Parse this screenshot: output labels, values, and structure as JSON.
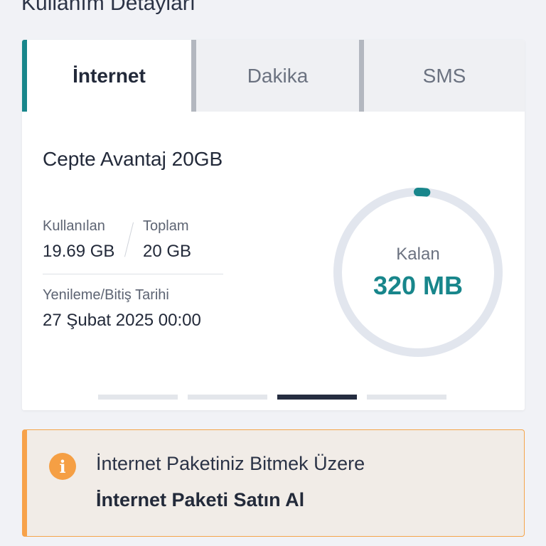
{
  "page": {
    "heading": "Kullanım Detayları"
  },
  "tabs": [
    {
      "label": "İnternet",
      "active": true
    },
    {
      "label": "Dakika",
      "active": false
    },
    {
      "label": "SMS",
      "active": false
    }
  ],
  "package": {
    "name": "Cepte Avantaj 20GB",
    "used_label": "Kullanılan",
    "used_value": "19.69 GB",
    "total_label": "Toplam",
    "total_value": "20 GB",
    "renewal_label": "Yenileme/Bitiş Tarihi",
    "renewal_value": "27 Şubat 2025 00:00"
  },
  "gauge": {
    "label": "Kalan",
    "value": "320 MB",
    "remaining_fraction": 0.016,
    "accent_color": "#18868b",
    "track_color": "#e2e6ee"
  },
  "pager": {
    "count": 4,
    "active_index": 2
  },
  "alert": {
    "icon": "info-icon",
    "message": "İnternet Paketiniz Bitmek Üzere",
    "action": "İnternet Paketi Satın Al",
    "accent_color": "#f59f44"
  }
}
